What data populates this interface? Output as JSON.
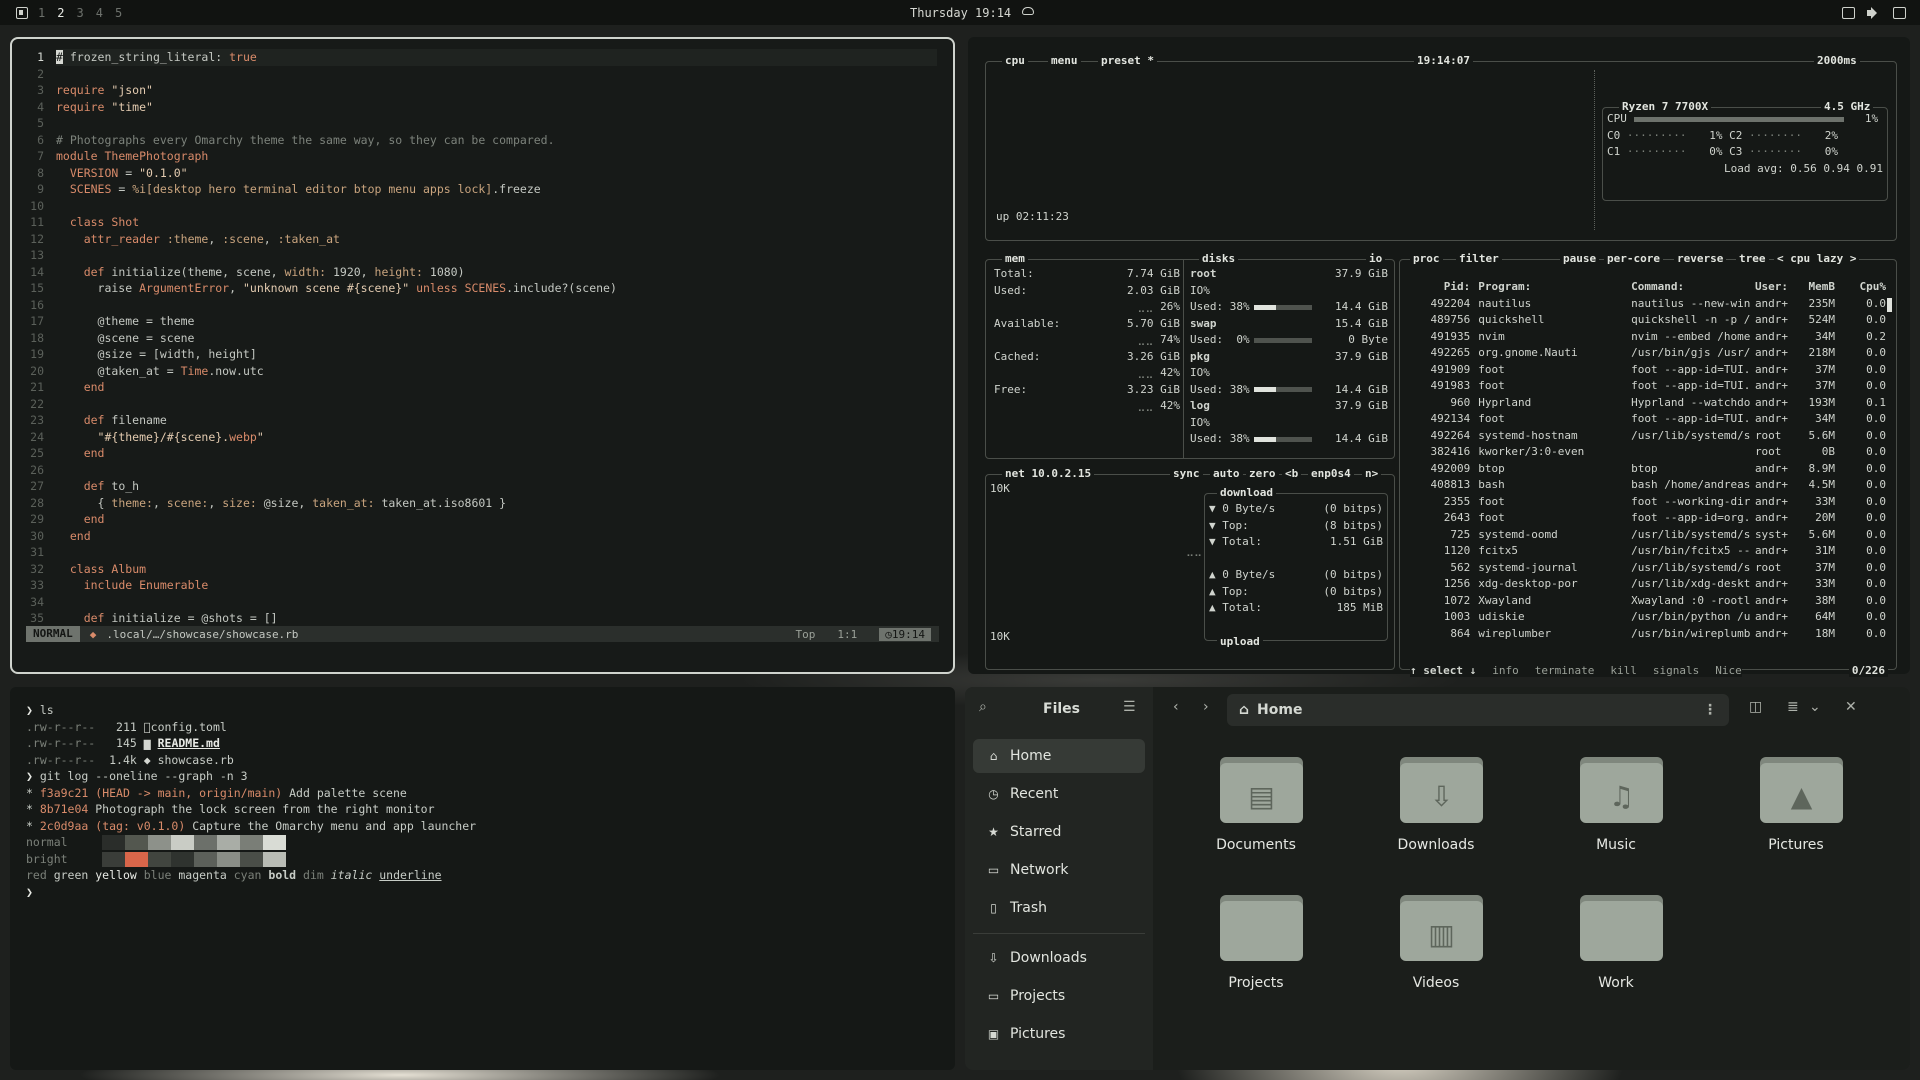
{
  "topbar": {
    "workspaces": [
      "1",
      "2",
      "3",
      "4",
      "5"
    ],
    "active_workspace": "2",
    "clock": "Thursday 19:14"
  },
  "editor": {
    "lines": [
      {
        "n": "1",
        "html": "<span class=\"cursor-block\">#</span> frozen_string_literal: <span class=\"k\">true</span>"
      },
      {
        "n": "2",
        "html": ""
      },
      {
        "n": "3",
        "html": "<span class=\"k\">require</span> <span class=\"s\">\"json\"</span>"
      },
      {
        "n": "4",
        "html": "<span class=\"k\">require</span> <span class=\"s\">\"time\"</span>"
      },
      {
        "n": "5",
        "html": ""
      },
      {
        "n": "6",
        "html": "<span class=\"c\"># Photographs every Omarchy theme the same way, so they can be compared.</span>"
      },
      {
        "n": "7",
        "html": "<span class=\"k\">module</span> <span class=\"cn\">ThemePhotograph</span>"
      },
      {
        "n": "8",
        "html": "  <span class=\"cn\">VERSION</span> = <span class=\"s\">\"0.1.0\"</span>"
      },
      {
        "n": "9",
        "html": "  <span class=\"cn\">SCENES</span> = <span class=\"sym\">%i[desktop hero terminal editor btop menu apps lock]</span>.freeze"
      },
      {
        "n": "10",
        "html": ""
      },
      {
        "n": "11",
        "html": "  <span class=\"k\">class</span> <span class=\"cn\">Shot</span>"
      },
      {
        "n": "12",
        "html": "    <span class=\"k\">attr_reader</span> <span class=\"sym\">:theme</span>, <span class=\"sym\">:scene</span>, <span class=\"sym\">:taken_at</span>"
      },
      {
        "n": "13",
        "html": ""
      },
      {
        "n": "14",
        "html": "    <span class=\"k\">def</span> initialize(theme, scene, <span class=\"sym\">width:</span> 1920, <span class=\"sym\">height:</span> 1080)"
      },
      {
        "n": "15",
        "html": "      raise <span class=\"cn\">ArgumentError</span>, <span class=\"s\">\"unknown scene #{scene}\"</span> <span class=\"k\">unless</span> <span class=\"cn\">SCENES</span>.include?(scene)"
      },
      {
        "n": "16",
        "html": ""
      },
      {
        "n": "17",
        "html": "      @theme = theme"
      },
      {
        "n": "18",
        "html": "      @scene = scene"
      },
      {
        "n": "19",
        "html": "      @size = [width, height]"
      },
      {
        "n": "20",
        "html": "      @taken_at = <span class=\"cn\">Time</span>.now.utc"
      },
      {
        "n": "21",
        "html": "    <span class=\"k\">end</span>"
      },
      {
        "n": "22",
        "html": ""
      },
      {
        "n": "23",
        "html": "    <span class=\"k\">def</span> filename"
      },
      {
        "n": "24",
        "html": "      <span class=\"s\">\"#{theme}/#{scene}.<span class=\"k\">webp</span>\"</span>"
      },
      {
        "n": "25",
        "html": "    <span class=\"k\">end</span>"
      },
      {
        "n": "26",
        "html": ""
      },
      {
        "n": "27",
        "html": "    <span class=\"k\">def</span> to_h"
      },
      {
        "n": "28",
        "html": "      { <span class=\"sym\">theme:</span>, <span class=\"sym\">scene:</span>, <span class=\"sym\">size:</span> @size, <span class=\"sym\">taken_at:</span> taken_at.iso8601 }"
      },
      {
        "n": "29",
        "html": "    <span class=\"k\">end</span>"
      },
      {
        "n": "30",
        "html": "  <span class=\"k\">end</span>"
      },
      {
        "n": "31",
        "html": ""
      },
      {
        "n": "32",
        "html": "  <span class=\"k\">class</span> <span class=\"cn\">Album</span>"
      },
      {
        "n": "33",
        "html": "    <span class=\"k\">include</span> <span class=\"cn\">Enumerable</span>"
      },
      {
        "n": "34",
        "html": ""
      },
      {
        "n": "35",
        "html": "    <span class=\"k\">def</span> initialize = @shots = []"
      }
    ],
    "status": {
      "mode": "NORMAL",
      "path": ".local/…/showcase/showcase.rb",
      "position": "Top",
      "cursor": "1:1",
      "time": "19:14"
    }
  },
  "btop": {
    "cpu": {
      "tabs": [
        "cpu",
        "menu",
        "preset *"
      ],
      "time": "19:14:07",
      "interval": "2000ms",
      "uptime": "up 02:11:23",
      "model": "Ryzen 7 7700X",
      "freq": "4.5 GHz",
      "total_label": "CPU",
      "total_pct": "1%",
      "cores": [
        {
          "name": "C0",
          "pct": "1%"
        },
        {
          "name": "C2",
          "pct": "2%"
        },
        {
          "name": "C1",
          "pct": "0%"
        },
        {
          "name": "C3",
          "pct": "0%"
        }
      ],
      "load_avg": "Load avg: 0.56 0.94 0.91"
    },
    "mem": {
      "title": "mem",
      "rows": [
        {
          "label": "Total:",
          "value": "7.74 GiB",
          "pct": ""
        },
        {
          "label": "Used:",
          "value": "2.03 GiB",
          "pct": "26%"
        },
        {
          "label": "Available:",
          "value": "5.70 GiB",
          "pct": "74%"
        },
        {
          "label": "Cached:",
          "value": "3.26 GiB",
          "pct": "42%"
        },
        {
          "label": "Free:",
          "value": "3.23 GiB",
          "pct": "42%"
        }
      ]
    },
    "disks": {
      "title": "disks",
      "io_label": "io",
      "items": [
        {
          "name": "root",
          "size": "37.9 GiB",
          "io": "IO%",
          "used": "Used: 38%",
          "used_val": "14.4 GiB",
          "used_frac": 0.38
        },
        {
          "name": "swap",
          "size": "15.4 GiB",
          "io": "",
          "used": "Used:  0%",
          "used_val": "0 Byte",
          "used_frac": 0.0
        },
        {
          "name": "pkg",
          "size": "37.9 GiB",
          "io": "IO%",
          "used": "Used: 38%",
          "used_val": "14.4 GiB",
          "used_frac": 0.38
        },
        {
          "name": "log",
          "size": "37.9 GiB",
          "io": "IO%",
          "used": "Used: 38%",
          "used_val": "14.4 GiB",
          "used_frac": 0.38
        }
      ]
    },
    "net": {
      "title": "net",
      "ip": "10.0.2.15",
      "controls": [
        "sync",
        "auto",
        "zero",
        "<b",
        "enp0s4",
        "n>"
      ],
      "scale_top": "10K",
      "scale_bottom": "10K",
      "download_label": "download",
      "download": [
        {
          "label": "▼ 0 Byte/s",
          "value": "(0 bitps)"
        },
        {
          "label": "▼ Top:",
          "value": "(8 bitps)"
        },
        {
          "label": "▼ Total:",
          "value": "1.51 GiB"
        }
      ],
      "upload": [
        {
          "label": "▲ 0 Byte/s",
          "value": "(0 bitps)"
        },
        {
          "label": "▲ Top:",
          "value": "(0 bitps)"
        },
        {
          "label": "▲ Total:",
          "value": "185 MiB"
        }
      ],
      "upload_label": "upload"
    },
    "proc": {
      "tabs": [
        "proc",
        "filter",
        "pause",
        "per-core",
        "reverse",
        "tree",
        "< cpu lazy >"
      ],
      "header": [
        "Pid:",
        "Program:",
        "Command:",
        "User:",
        "MemB",
        "Cpu%"
      ],
      "rows": [
        [
          "492204",
          "nautilus",
          "nautilus --new-win",
          "andr+",
          "235M",
          "0.0"
        ],
        [
          "489756",
          "quickshell",
          "quickshell -n -p /",
          "andr+",
          "524M",
          "0.0"
        ],
        [
          "491935",
          "nvim",
          "nvim --embed /home",
          "andr+",
          "34M",
          "0.2"
        ],
        [
          "492265",
          "org.gnome.Nauti",
          "/usr/bin/gjs /usr/",
          "andr+",
          "218M",
          "0.0"
        ],
        [
          "491909",
          "foot",
          "foot --app-id=TUI.",
          "andr+",
          "37M",
          "0.0"
        ],
        [
          "491983",
          "foot",
          "foot --app-id=TUI.",
          "andr+",
          "37M",
          "0.0"
        ],
        [
          "960",
          "Hyprland",
          "Hyprland --watchdo",
          "andr+",
          "193M",
          "0.1"
        ],
        [
          "492134",
          "foot",
          "foot --app-id=TUI.",
          "andr+",
          "34M",
          "0.0"
        ],
        [
          "492264",
          "systemd-hostnam",
          "/usr/lib/systemd/s",
          "root",
          "5.6M",
          "0.0"
        ],
        [
          "382416",
          "kworker/3:0-even",
          "",
          "root",
          "0B",
          "0.0"
        ],
        [
          "492009",
          "btop",
          "btop",
          "andr+",
          "8.9M",
          "0.0"
        ],
        [
          "408813",
          "bash",
          "bash /home/andreas",
          "andr+",
          "4.5M",
          "0.0"
        ],
        [
          "2355",
          "foot",
          "foot --working-dir",
          "andr+",
          "33M",
          "0.0"
        ],
        [
          "2643",
          "foot",
          "foot --app-id=org.",
          "andr+",
          "20M",
          "0.0"
        ],
        [
          "725",
          "systemd-oomd",
          "/usr/lib/systemd/s",
          "syst+",
          "5.6M",
          "0.0"
        ],
        [
          "1120",
          "fcitx5",
          "/usr/bin/fcitx5 --",
          "andr+",
          "31M",
          "0.0"
        ],
        [
          "562",
          "systemd-journal",
          "/usr/lib/systemd/s",
          "root",
          "37M",
          "0.0"
        ],
        [
          "1256",
          "xdg-desktop-por",
          "/usr/lib/xdg-deskt",
          "andr+",
          "33M",
          "0.0"
        ],
        [
          "1072",
          "Xwayland",
          "Xwayland :0 -rootl",
          "andr+",
          "38M",
          "0.0"
        ],
        [
          "1003",
          "udiskie",
          "/usr/bin/python /u",
          "andr+",
          "64M",
          "0.0"
        ],
        [
          "864",
          "wireplumber",
          "/usr/bin/wireplumb",
          "andr+",
          "18M",
          "0.0"
        ]
      ],
      "footer": [
        "↑ select ↓",
        "info",
        "terminate",
        "kill",
        "signals",
        "Nice"
      ],
      "count": "0/226"
    }
  },
  "terminal": {
    "lines": [
      {
        "html": "<span style=\"color:#e8eae5\">❯</span> ls"
      },
      {
        "html": "<span class=\"dim\">.rw-r--r--</span>   211 <span style=\"color:#d4d7d1\">󰈮</span>config.toml"
      },
      {
        "html": "<span class=\"dim\">.rw-r--r--</span>   145 <span style=\"color:#d4d7d1\">▆</span> <u style=\"color:#e8eae5;font-weight:bold\">README.md</u>"
      },
      {
        "html": "<span class=\"dim\">.rw-r--r--</span>  1.4k <span style=\"color:#d4d7d1\">◆</span> showcase.rb"
      },
      {
        "html": "<span style=\"color:#e8eae5\">❯</span> git log --oneline --graph -n 3"
      },
      {
        "html": "* <span class=\"k\">f3a9c21</span> <span class=\"k\">(HEAD -> main, origin/main)</span> Add palette scene"
      },
      {
        "html": "* <span class=\"k\">8b71e04</span> Photograph the lock screen from the right monitor"
      },
      {
        "html": "* <span class=\"k\">2c0d9aa</span> <span class=\"k\">(tag: v0.1.0)</span> Capture the Omarchy menu and app launcher"
      },
      {
        "html": "<span class=\"dim\">normal</span>     <span class=\"swatch\" style=\"background:#2a2d2a\"></span><span class=\"swatch\" style=\"background:#53574f\"></span><span class=\"swatch\" style=\"background:#8d918a\"></span><span class=\"swatch\" style=\"background:#c9ccc5\"></span><span class=\"swatch\" style=\"background:#6c706a\"></span><span class=\"swatch\" style=\"background:#a9ada6\"></span><span class=\"swatch\" style=\"background:#7a7e77\"></span><span class=\"swatch\" style=\"background:#d9dcd5\"></span>"
      },
      {
        "html": "<span class=\"dim\">bright</span>     <span class=\"swatch\" style=\"background:#3a3d39\"></span><span class=\"swatch\" style=\"background:#d9664a\"></span><span class=\"swatch\" style=\"background:#41453f\"></span><span class=\"swatch\" style=\"background:#2f332f\"></span><span class=\"swatch\" style=\"background:#5c605a\"></span><span class=\"swatch\" style=\"background:#8a8e87\"></span><span class=\"swatch\" style=\"background:#4a4e48\"></span><span class=\"swatch\" style=\"background:#b9bcb5\"></span>"
      },
      {
        "html": "<span class=\"dim\">red</span> green <span style=\"color:#e8eae5\">yellow</span> <span class=\"dim\">blue</span> magenta <span class=\"dim\">cyan</span> <b>bold</b> <span class=\"dim\">dim</span> <i>italic</i> <u>underline</u>"
      },
      {
        "html": "<span style=\"color:#e8eae5\">❯</span>"
      }
    ]
  },
  "files": {
    "title": "Files",
    "path": "Home",
    "nav": [
      {
        "label": "Home",
        "icon": "home-icon",
        "glyph": "⌂",
        "active": true
      },
      {
        "label": "Recent",
        "icon": "clock-icon",
        "glyph": "◷",
        "active": false
      },
      {
        "label": "Starred",
        "icon": "star-icon",
        "glyph": "★",
        "active": false
      },
      {
        "label": "Network",
        "icon": "network-icon",
        "glyph": "▭",
        "active": false
      },
      {
        "label": "Trash",
        "icon": "trash-icon",
        "glyph": "▯",
        "active": false
      }
    ],
    "bookmarks": [
      {
        "label": "Downloads",
        "icon": "download-icon",
        "glyph": "⇩"
      },
      {
        "label": "Projects",
        "icon": "folder-icon",
        "glyph": "▭"
      },
      {
        "label": "Pictures",
        "icon": "picture-icon",
        "glyph": "▣"
      }
    ],
    "folders": [
      {
        "label": "Documents",
        "icon": "document-folder-icon",
        "glyph": "▤"
      },
      {
        "label": "Downloads",
        "icon": "download-folder-icon",
        "glyph": "⇩"
      },
      {
        "label": "Music",
        "icon": "music-folder-icon",
        "glyph": "♫"
      },
      {
        "label": "Pictures",
        "icon": "picture-folder-icon",
        "glyph": "▲"
      },
      {
        "label": "Projects",
        "icon": "folder-icon",
        "glyph": ""
      },
      {
        "label": "Videos",
        "icon": "video-folder-icon",
        "glyph": "▥"
      },
      {
        "label": "Work",
        "icon": "folder-icon",
        "glyph": ""
      }
    ]
  }
}
